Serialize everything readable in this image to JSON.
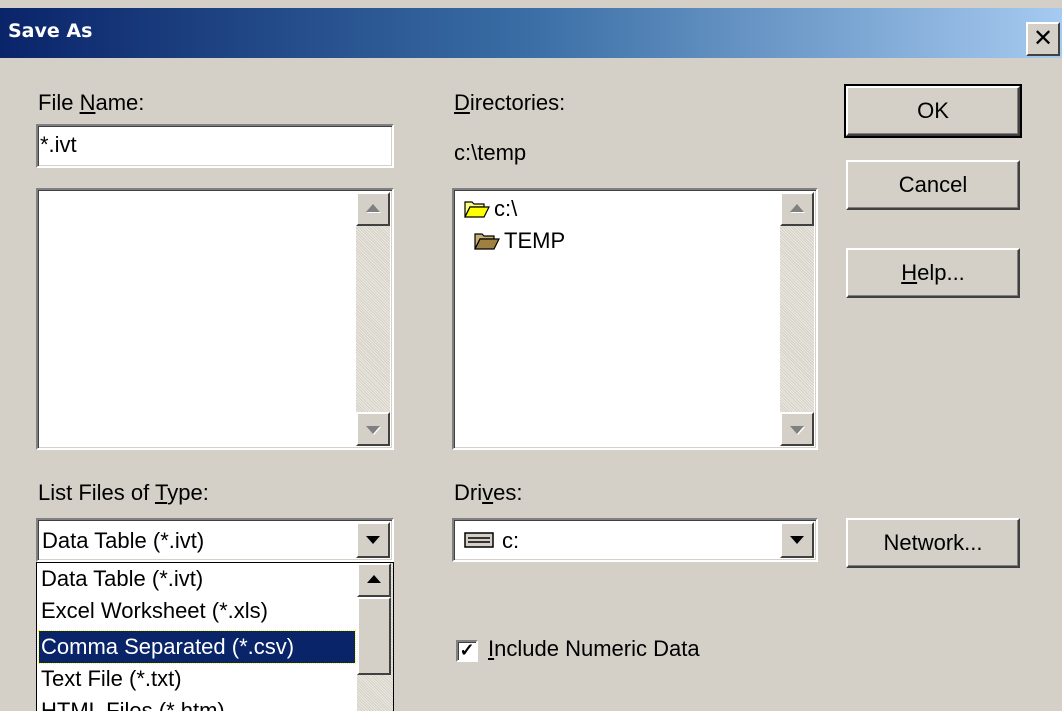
{
  "window": {
    "title": "Save As",
    "close_glyph": "✕"
  },
  "file_name": {
    "label_pre": "File ",
    "label_u": "N",
    "label_post": "ame:",
    "value": "*.ivt"
  },
  "directories": {
    "label_u": "D",
    "label_post": "irectories:",
    "current_path": "c:\\temp",
    "tree": [
      {
        "label": "c:\\",
        "icon": "open-folder-icon"
      },
      {
        "label": "TEMP",
        "icon": "open-folder-icon"
      }
    ]
  },
  "buttons": {
    "ok": "OK",
    "cancel": "Cancel",
    "help_u": "H",
    "help_post": "elp...",
    "network": "Network..."
  },
  "file_type": {
    "label_pre": "List Files of ",
    "label_u": "T",
    "label_post": "ype:",
    "selected": "Data Table (*.ivt)",
    "options": [
      "Data Table (*.ivt)",
      "Excel Worksheet (*.xls)",
      "Comma Separated (*.csv)",
      "Text File (*.txt)",
      "HTML Files (*.htm)"
    ],
    "highlighted_index": 2
  },
  "drives": {
    "label_pre": "Dri",
    "label_u": "v",
    "label_post": "es:",
    "selected": "c:",
    "icon": "drive-icon"
  },
  "include_numeric": {
    "label_u": "I",
    "label_post": "nclude Numeric Data",
    "checked": true,
    "check_glyph": "✓"
  }
}
